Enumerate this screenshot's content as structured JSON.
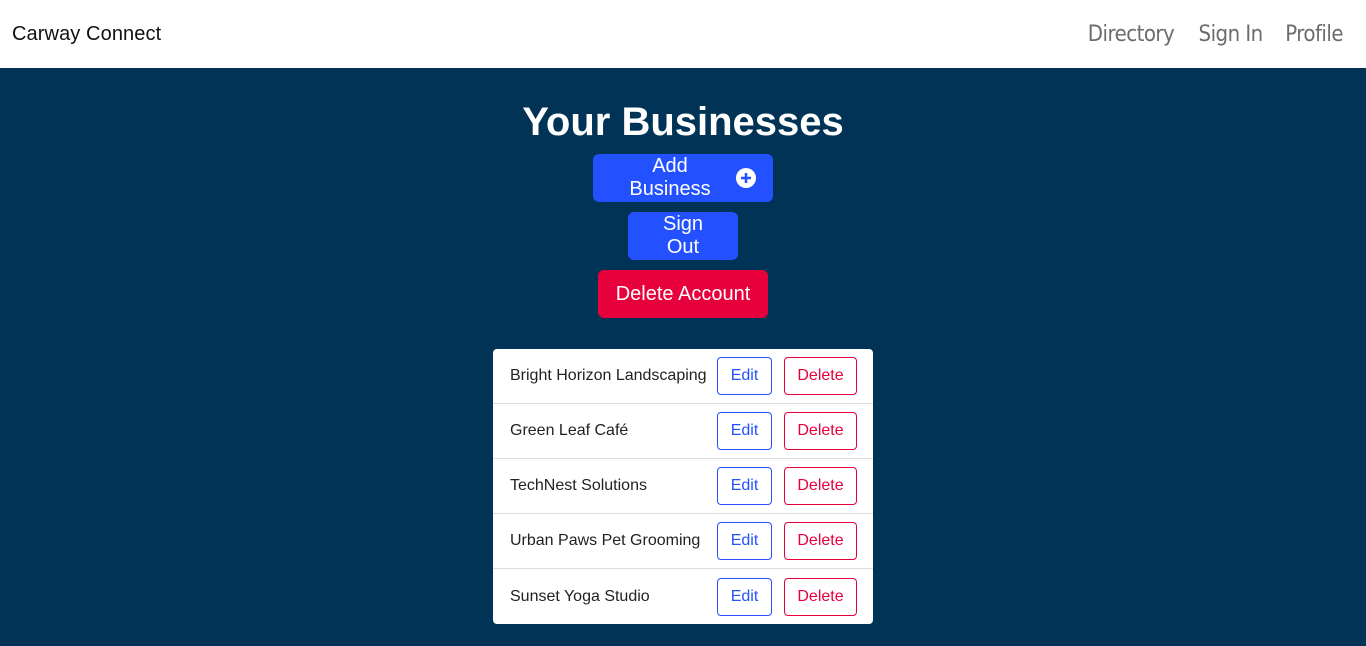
{
  "navbar": {
    "brand": "Carway Connect",
    "links": [
      "Directory",
      "Sign In",
      "Profile"
    ]
  },
  "main": {
    "title": "Your Businesses",
    "add_business_label": "Add Business",
    "add_icon": "plus-circle-icon",
    "sign_out_label": "Sign Out",
    "delete_account_label": "Delete Account"
  },
  "businesses": [
    {
      "name": "Bright Horizon Landscaping",
      "edit_label": "Edit",
      "delete_label": "Delete"
    },
    {
      "name": "Green Leaf Café",
      "edit_label": "Edit",
      "delete_label": "Delete"
    },
    {
      "name": "TechNest Solutions",
      "edit_label": "Edit",
      "delete_label": "Delete"
    },
    {
      "name": "Urban Paws Pet Grooming",
      "edit_label": "Edit",
      "delete_label": "Delete"
    },
    {
      "name": "Sunset Yoga Studio",
      "edit_label": "Edit",
      "delete_label": "Delete"
    }
  ],
  "colors": {
    "background": "#003355",
    "primary": "#2451ff",
    "danger": "#e8003d",
    "navbar": "#ffffff"
  }
}
